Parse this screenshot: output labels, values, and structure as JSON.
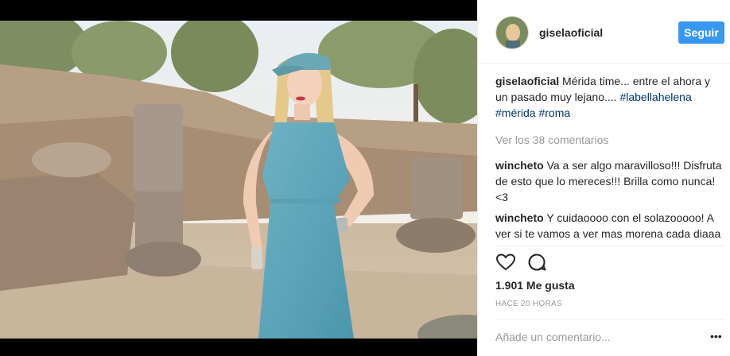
{
  "post": {
    "username": "giselaoficial",
    "follow_label": "Seguir",
    "caption_user": "giselaoficial",
    "caption_text": "Mérida time... entre el ahora y un pasado muy lejano....",
    "hashtags": [
      "#labellahelena",
      "#mérida",
      "#roma"
    ],
    "view_all_comments": "Ver los 38 comentarios",
    "comments": [
      {
        "user": "wincheto",
        "text": "Va a ser algo maravilloso!!! Disfruta de esto que lo mereces!!! Brilla como nunca! <3"
      },
      {
        "user": "wincheto",
        "text": "Y cuidaoooo con el solazooooo! A ver si te vamos a ver mas morena cada diaaa jaja ☀☀☀☀"
      }
    ],
    "likes": "1.901 Me gusta",
    "time_ago": "HACE 20 HORAS",
    "comment_placeholder": "Añade un comentario...",
    "more_glyph": "•••"
  },
  "icons": {
    "like": "heart-icon",
    "comment": "speech-bubble-icon",
    "more": "more-options-icon"
  },
  "colors": {
    "accent": "#3897f0",
    "hashtag": "#003569",
    "muted": "#999999",
    "text": "#262626"
  }
}
